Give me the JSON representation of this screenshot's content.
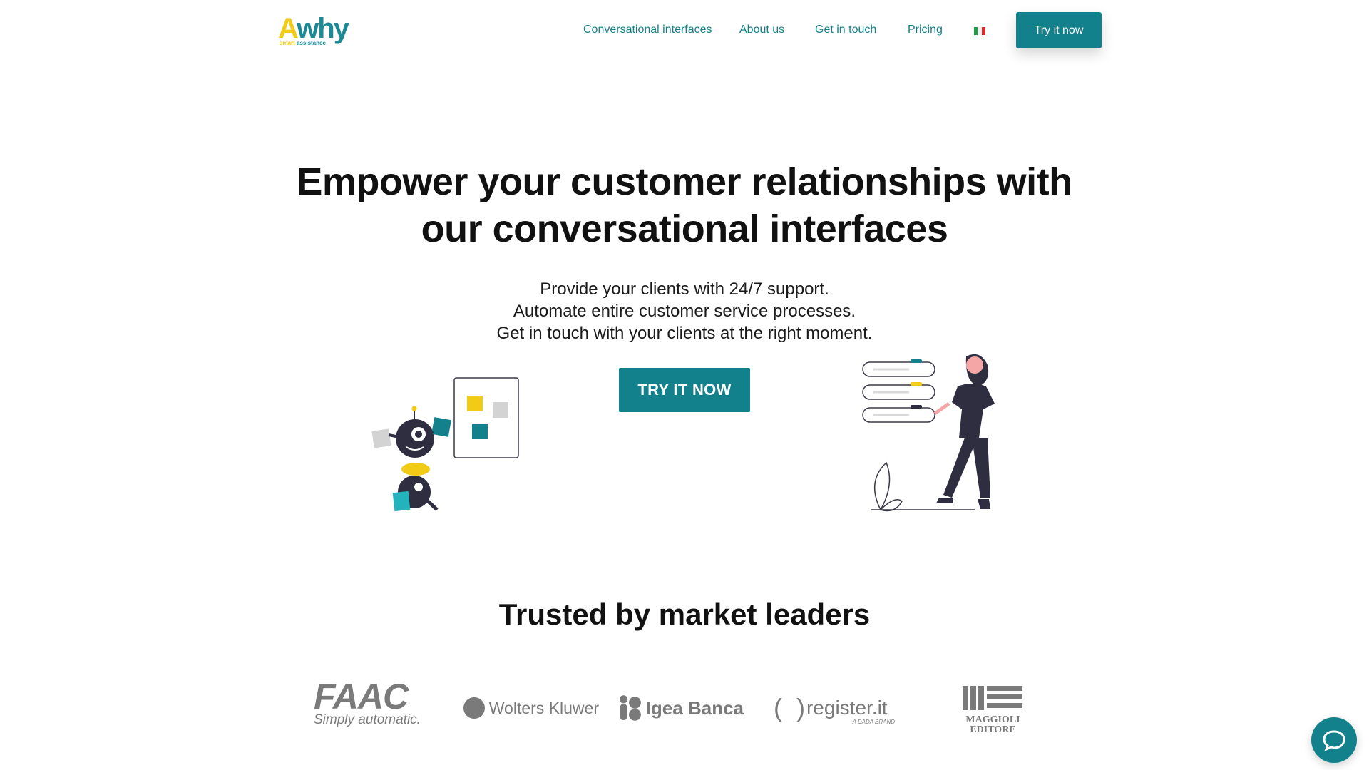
{
  "brand": {
    "logo_text": "Awhy",
    "logo_tagline": "smart assistance",
    "colors": {
      "primary": "#13818b",
      "accent": "#f2cb16",
      "dark": "#2f2e41"
    }
  },
  "nav": {
    "items": [
      {
        "label": "Conversational interfaces"
      },
      {
        "label": "About us"
      },
      {
        "label": "Get in touch"
      },
      {
        "label": "Pricing"
      }
    ],
    "language_flag": "italy-flag-icon",
    "cta_label": "Try it now"
  },
  "hero": {
    "title_line1": "Empower your customer relationships with",
    "title_line2": "our conversational interfaces",
    "subtitle_lines": [
      "Provide your clients with 24/7 support.",
      "Automate entire customer service processes.",
      "Get in touch with your clients at the right moment."
    ],
    "cta_label": "TRY IT NOW"
  },
  "trusted": {
    "title": "Trusted by market leaders",
    "clients": [
      {
        "name": "FAAC",
        "tagline": "Simply automatic."
      },
      {
        "name": "Wolters Kluwer"
      },
      {
        "name": "Igea Banca"
      },
      {
        "name": "register.it",
        "tagline": "A DADA BRAND"
      },
      {
        "name": "MAGGIOLI",
        "tagline": "EDITORE"
      }
    ]
  },
  "chat_widget": {
    "icon": "chat-bubble-icon"
  }
}
